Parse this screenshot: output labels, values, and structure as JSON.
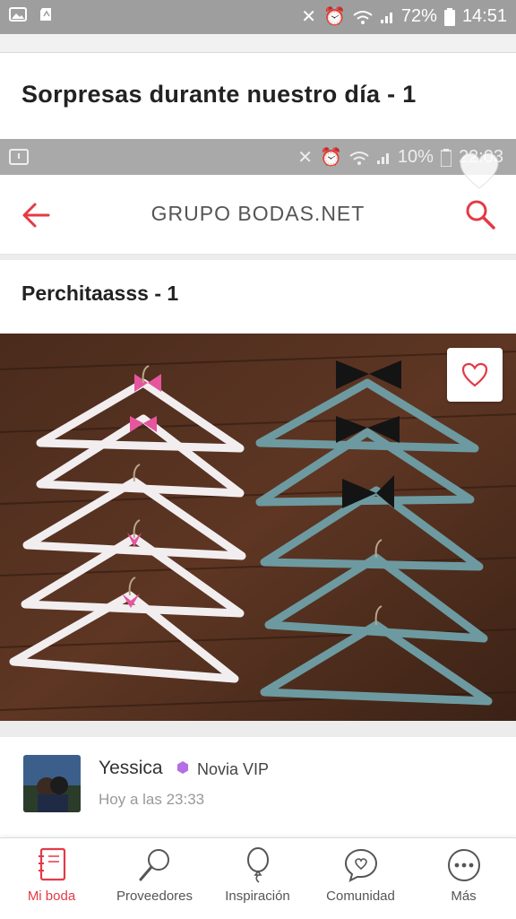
{
  "status_outer": {
    "battery": "72%",
    "time": "14:51"
  },
  "post": {
    "title": "Sorpresas durante nuestro día - 1"
  },
  "status_inner": {
    "battery": "10%",
    "time": "22:03"
  },
  "app_header": {
    "title": "GRUPO BODAS.NET"
  },
  "gallery": {
    "subtitle": "Perchitaasss - 1"
  },
  "comment": {
    "author": "Yessica",
    "badge": "Novia VIP",
    "time": "Hoy a las 23:33",
    "badge_color": "#b46ee6"
  },
  "bottom_nav": {
    "items": [
      {
        "label": "Mi boda",
        "icon": "notebook-icon",
        "active": true
      },
      {
        "label": "Proveedores",
        "icon": "magnifier-icon",
        "active": false
      },
      {
        "label": "Inspiración",
        "icon": "balloon-icon",
        "active": false
      },
      {
        "label": "Comunidad",
        "icon": "chat-heart-icon",
        "active": false
      },
      {
        "label": "Más",
        "icon": "more-dots-icon",
        "active": false
      }
    ]
  },
  "colors": {
    "accent": "#e33a45",
    "statusbar": "#9e9e9e"
  }
}
